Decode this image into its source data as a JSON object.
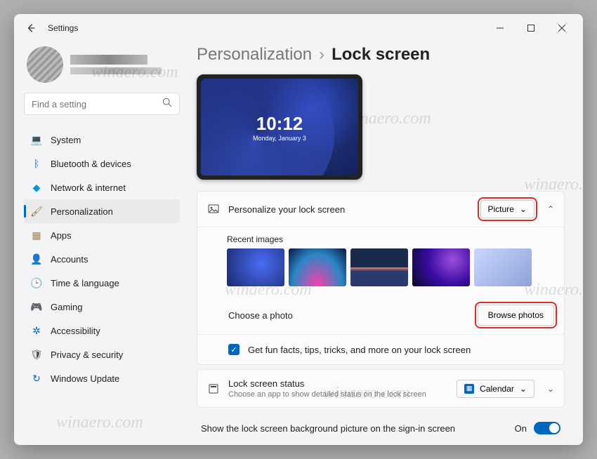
{
  "window": {
    "title": "Settings"
  },
  "search": {
    "placeholder": "Find a setting"
  },
  "sidebar": {
    "items": [
      {
        "label": "System",
        "icon": "💻",
        "color": "#0067c0"
      },
      {
        "label": "Bluetooth & devices",
        "icon": "ᛒ",
        "color": "#0067c0"
      },
      {
        "label": "Network & internet",
        "icon": "◆",
        "color": "#0099d8"
      },
      {
        "label": "Personalization",
        "icon": "🖌",
        "color": "#8a6d3b"
      },
      {
        "label": "Apps",
        "icon": "▦",
        "color": "#b08030"
      },
      {
        "label": "Accounts",
        "icon": "👤",
        "color": "#2e8b57"
      },
      {
        "label": "Time & language",
        "icon": "🕒",
        "color": "#555"
      },
      {
        "label": "Gaming",
        "icon": "🎮",
        "color": "#666"
      },
      {
        "label": "Accessibility",
        "icon": "✲",
        "color": "#0067c0"
      },
      {
        "label": "Privacy & security",
        "icon": "🛡",
        "color": "#555"
      },
      {
        "label": "Windows Update",
        "icon": "↻",
        "color": "#0067c0"
      }
    ],
    "active_index": 3
  },
  "breadcrumb": {
    "parent": "Personalization",
    "sep": "›",
    "current": "Lock screen"
  },
  "preview": {
    "time": "10:12",
    "date": "Monday, January 3"
  },
  "personalize": {
    "title": "Personalize your lock screen",
    "dropdown": "Picture",
    "recent_label": "Recent images",
    "choose_label": "Choose a photo",
    "browse_label": "Browse photos",
    "funfacts_label": "Get fun facts, tips, tricks, and more on your lock screen",
    "funfacts_checked": true
  },
  "status": {
    "title": "Lock screen status",
    "sub": "Choose an app to show detailed status on the lock screen",
    "app": "Calendar"
  },
  "signin": {
    "label": "Show the lock screen background picture on the sign-in screen",
    "state": "On"
  },
  "watermark": "winaero.com"
}
